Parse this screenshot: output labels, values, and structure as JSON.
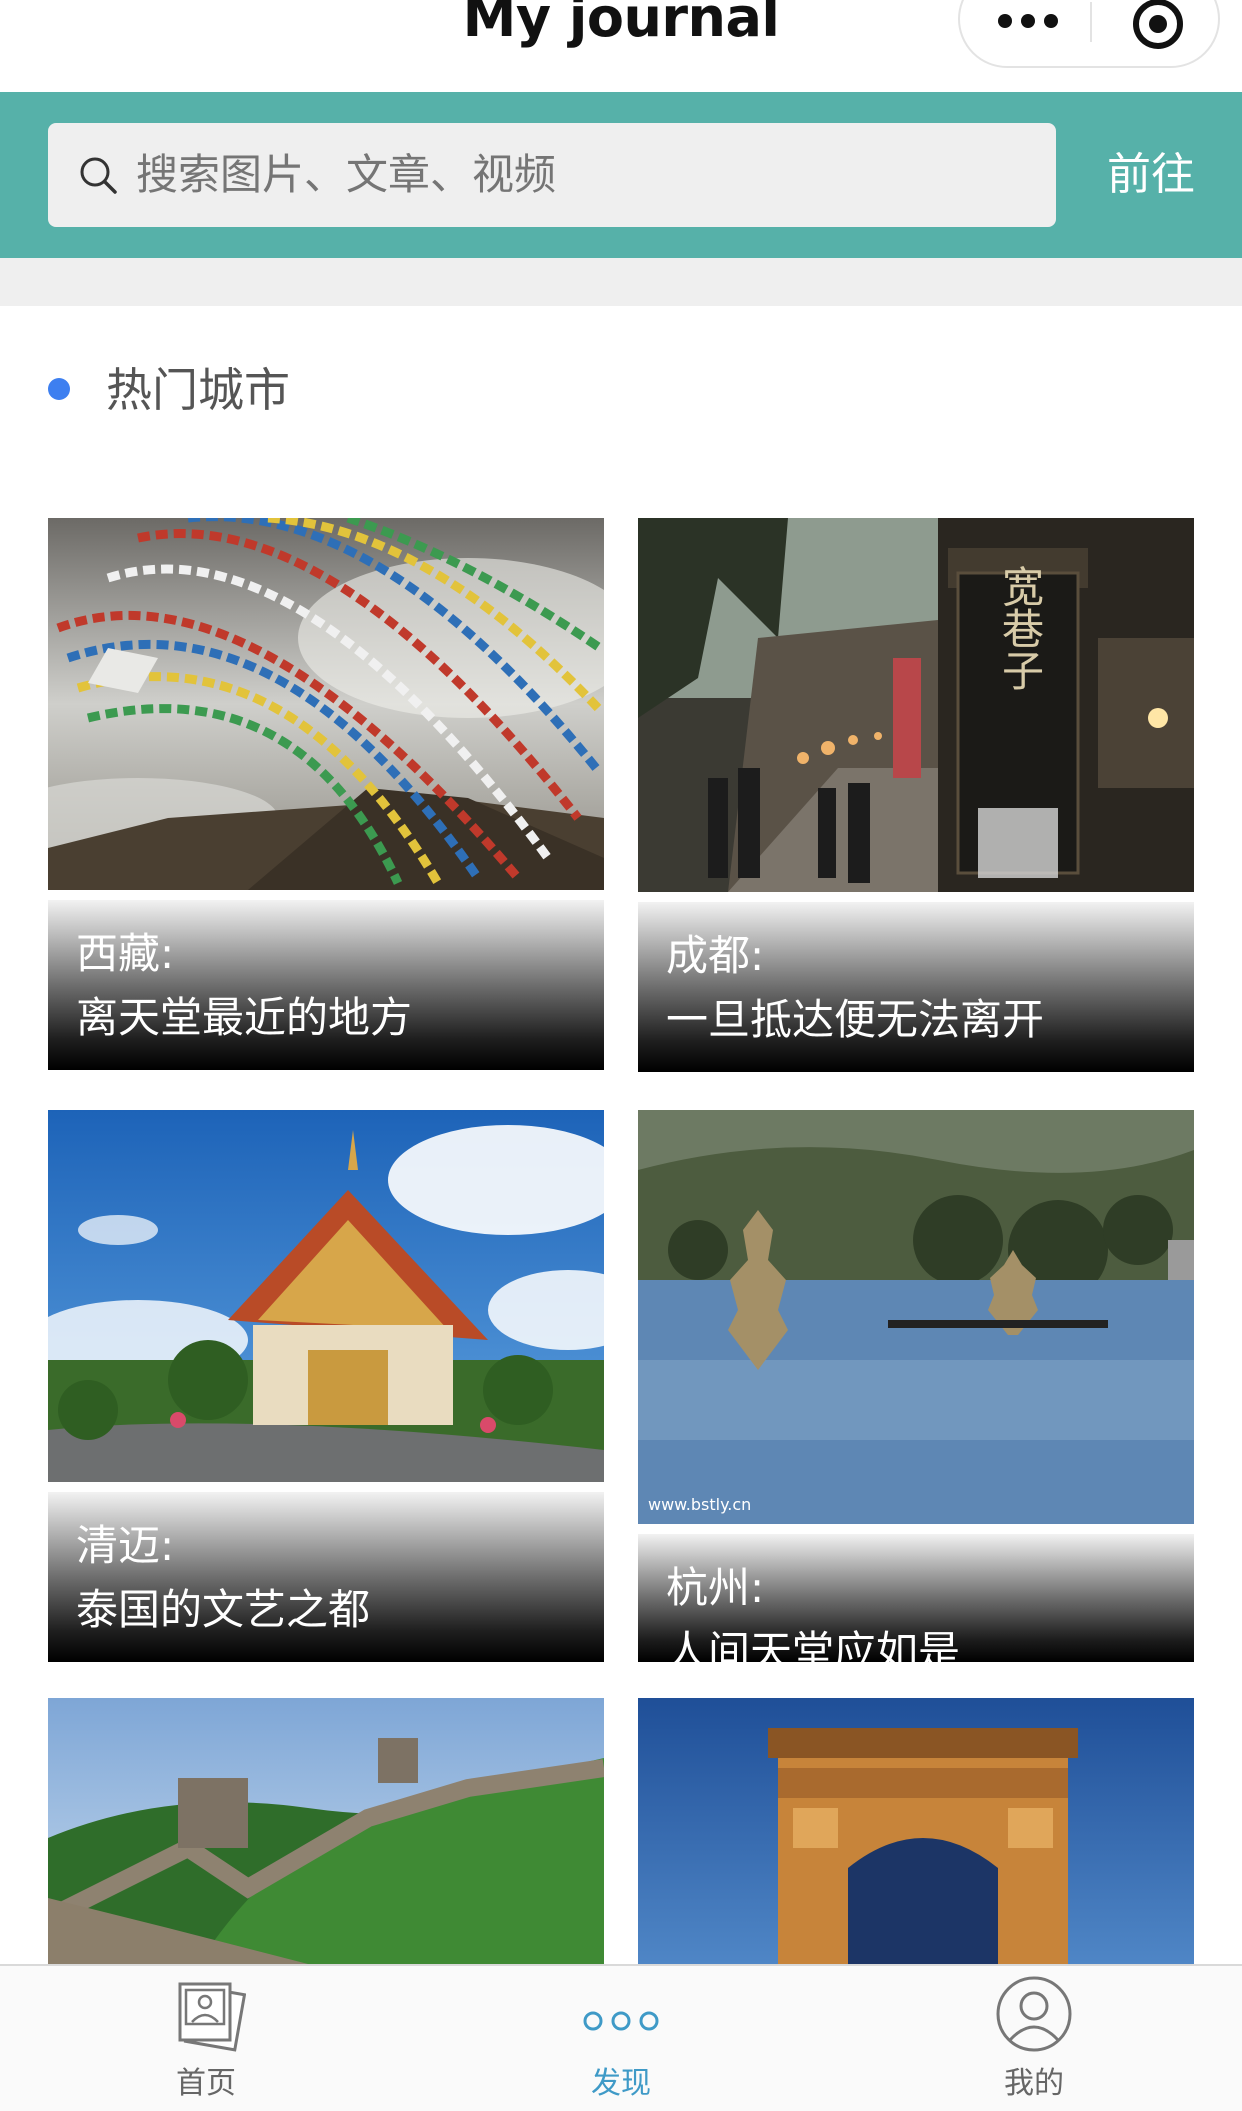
{
  "app": {
    "title": "My journal"
  },
  "search": {
    "placeholder": "搜索图片、文章、视频",
    "go_label": "前往"
  },
  "section": {
    "title": "热门城市"
  },
  "cards": [
    {
      "city": "西藏:",
      "slogan": "离天堂最近的地方"
    },
    {
      "city": "成都:",
      "slogan": "一旦抵达便无法离开"
    },
    {
      "city": "清迈:",
      "slogan": "泰国的文艺之都"
    },
    {
      "city": "杭州:",
      "slogan": "人间天堂应如是"
    },
    {
      "city": "",
      "slogan": ""
    },
    {
      "city": "",
      "slogan": ""
    }
  ],
  "photo_texts": {
    "sign": "宽巷子",
    "watermark": "www.bstly.cn"
  },
  "tabbar": {
    "items": [
      {
        "label": "首页",
        "icon": "photos-icon",
        "active": false
      },
      {
        "label": "发现",
        "icon": "dots-icon",
        "active": true
      },
      {
        "label": "我的",
        "icon": "user-icon",
        "active": false
      }
    ]
  },
  "colors": {
    "header": "#56b1a9",
    "bullet": "#3d7ff0",
    "active_tab": "#3f9ac7"
  }
}
